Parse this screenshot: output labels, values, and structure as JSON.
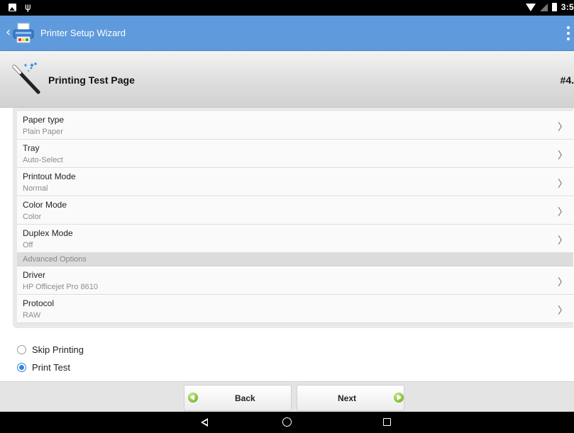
{
  "status_bar": {
    "time": "3:5",
    "icons": [
      "image-icon",
      "usb-icon",
      "wifi-icon",
      "no-signal-icon",
      "battery-icon"
    ]
  },
  "action_bar": {
    "title": "Printer Setup Wizard",
    "color": "#5f9bdc"
  },
  "header": {
    "title": "Printing Test Page",
    "step": "#4."
  },
  "settings": {
    "rows": [
      {
        "label": "Paper type",
        "value": "Plain Paper"
      },
      {
        "label": "Tray",
        "value": "Auto-Select"
      },
      {
        "label": "Printout Mode",
        "value": "Normal"
      },
      {
        "label": "Color Mode",
        "value": "Color"
      },
      {
        "label": "Duplex Mode",
        "value": "Off"
      }
    ],
    "advanced_header": "Advanced Options",
    "advanced_rows": [
      {
        "label": "Driver",
        "value": "HP Officejet Pro 8610"
      },
      {
        "label": "Protocol",
        "value": "RAW"
      }
    ]
  },
  "options": {
    "skip_label": "Skip Printing",
    "skip_checked": false,
    "print_label": "Print Test",
    "print_checked": true
  },
  "buttons": {
    "back": "Back",
    "next": "Next"
  },
  "accent_color": "#2f86d9"
}
